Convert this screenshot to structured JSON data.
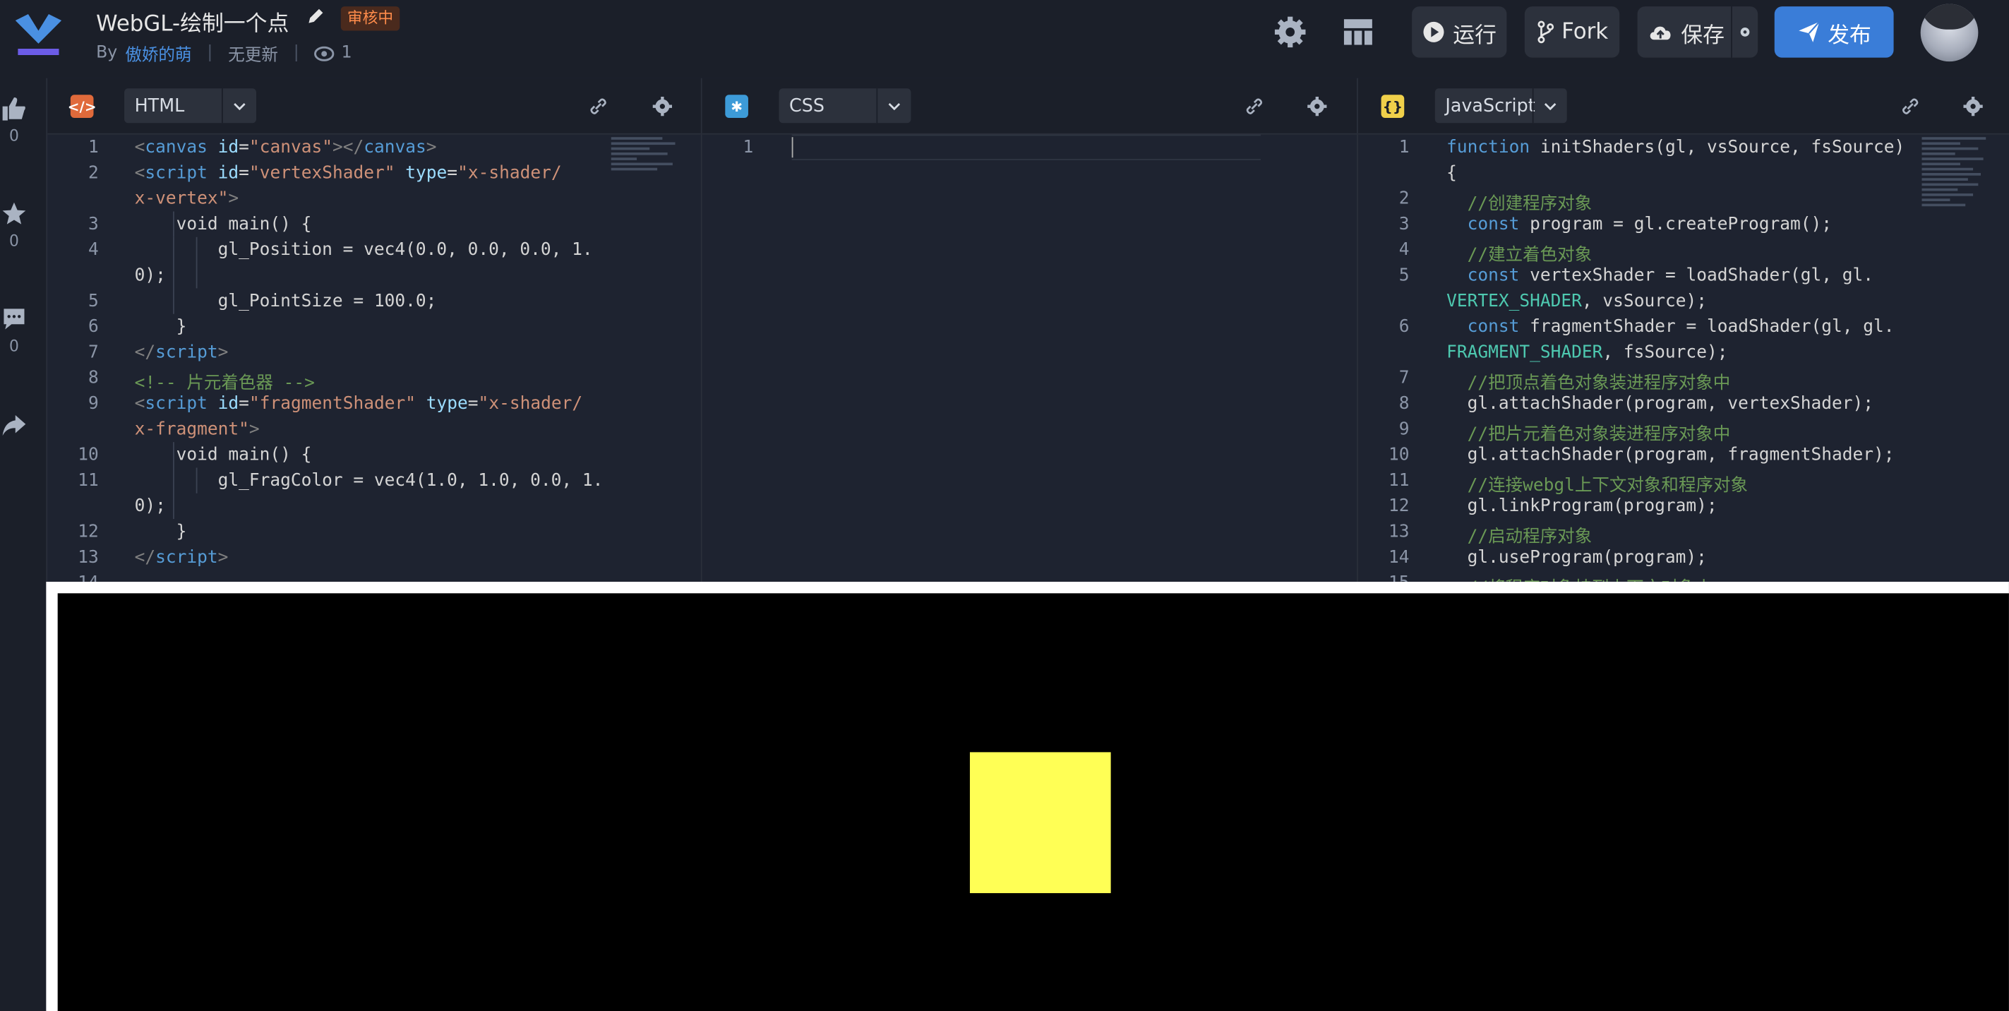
{
  "header": {
    "title": "WebGL-绘制一个点",
    "status_badge": "审核中",
    "by_label": "By",
    "author": "傲娇的萌",
    "update_status": "无更新",
    "views": "1",
    "buttons": {
      "run": "运行",
      "fork": "Fork",
      "save": "保存",
      "publish": "发布"
    }
  },
  "sidebar": {
    "likes": "0",
    "favorites": "0",
    "comments": "0"
  },
  "editors": {
    "html": {
      "language": "HTML"
    },
    "css": {
      "language": "CSS"
    },
    "js": {
      "language": "JavaScript"
    }
  },
  "colors": {
    "accent": "#3a7dd8",
    "badge": "#ff8c4b",
    "preview_square": "#ffff55"
  }
}
